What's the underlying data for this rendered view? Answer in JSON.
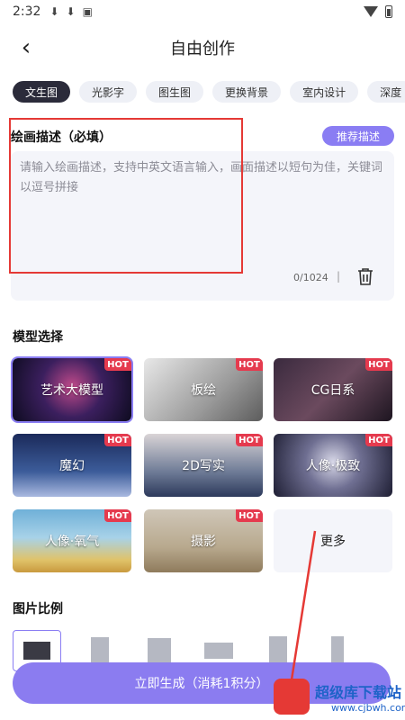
{
  "status_bar": {
    "time": "2:32",
    "icons": [
      "download-icon",
      "download-icon",
      "app-icon"
    ]
  },
  "header": {
    "back_icon": "back-arrow-icon",
    "title": "自由创作"
  },
  "tabs": [
    {
      "label": "文生图",
      "active": true
    },
    {
      "label": "光影字"
    },
    {
      "label": "图生图"
    },
    {
      "label": "更换背景"
    },
    {
      "label": "室内设计"
    },
    {
      "label": "深度"
    }
  ],
  "prompt": {
    "title": "绘画描述（必填）",
    "recommend_label": "推荐描述",
    "placeholder": "请输入绘画描述，支持中英文语言输入，画面描述以短句为佳，关键词以逗号拼接",
    "counter": "0/1024",
    "separator": "|"
  },
  "models": {
    "title": "模型选择",
    "hot_label": "HOT",
    "items": [
      {
        "name": "艺术大模型",
        "hot": true,
        "selected": true
      },
      {
        "name": "板绘",
        "hot": true
      },
      {
        "name": "CG日系",
        "hot": true
      },
      {
        "name": "魔幻",
        "hot": true
      },
      {
        "name": "2D写实",
        "hot": true
      },
      {
        "name": "人像·极致",
        "hot": true
      },
      {
        "name": "人像·氧气",
        "hot": true
      },
      {
        "name": "摄影",
        "hot": true
      },
      {
        "name": "更多",
        "hot": false
      }
    ]
  },
  "ratio": {
    "title": "图片比例"
  },
  "generate": {
    "label": "立即生成（消耗1积分）"
  },
  "watermark": {
    "brand": "超级库下载站",
    "url": "www.cjbwh.com"
  },
  "colors": {
    "accent": "#8b7cf0",
    "hot": "#e53a4e",
    "highlight": "#e53935"
  }
}
